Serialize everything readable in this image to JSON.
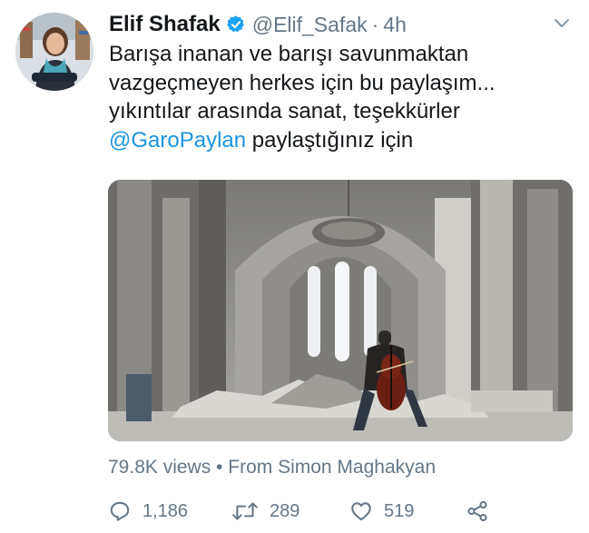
{
  "tweet": {
    "author_name": "Elif Shafak",
    "handle": "@Elif_Safak",
    "separator": "·",
    "time": "4h",
    "text_lines": [
      "Barışa inanan ve barışı savunmaktan",
      "vazgeçmeyen herkes için bu paylaşım...",
      "yıkıntılar arasında sanat, teşekkürler"
    ],
    "mention": "@GaroPaylan",
    "text_tail": " paylaştığınız için",
    "views_line": "79.8K views • From Simon Maghakyan"
  },
  "actions": {
    "reply_count": "1,186",
    "retweet_count": "289",
    "like_count": "519"
  },
  "icons": {
    "verified": "verified-badge-icon",
    "menu": "chevron-down-icon",
    "reply": "reply-icon",
    "retweet": "retweet-icon",
    "like": "heart-icon",
    "share": "share-icon"
  },
  "colors": {
    "verified_blue": "#1da1f2",
    "link_blue": "#1b95e0",
    "muted_gray": "#657786",
    "text": "#14171a"
  }
}
